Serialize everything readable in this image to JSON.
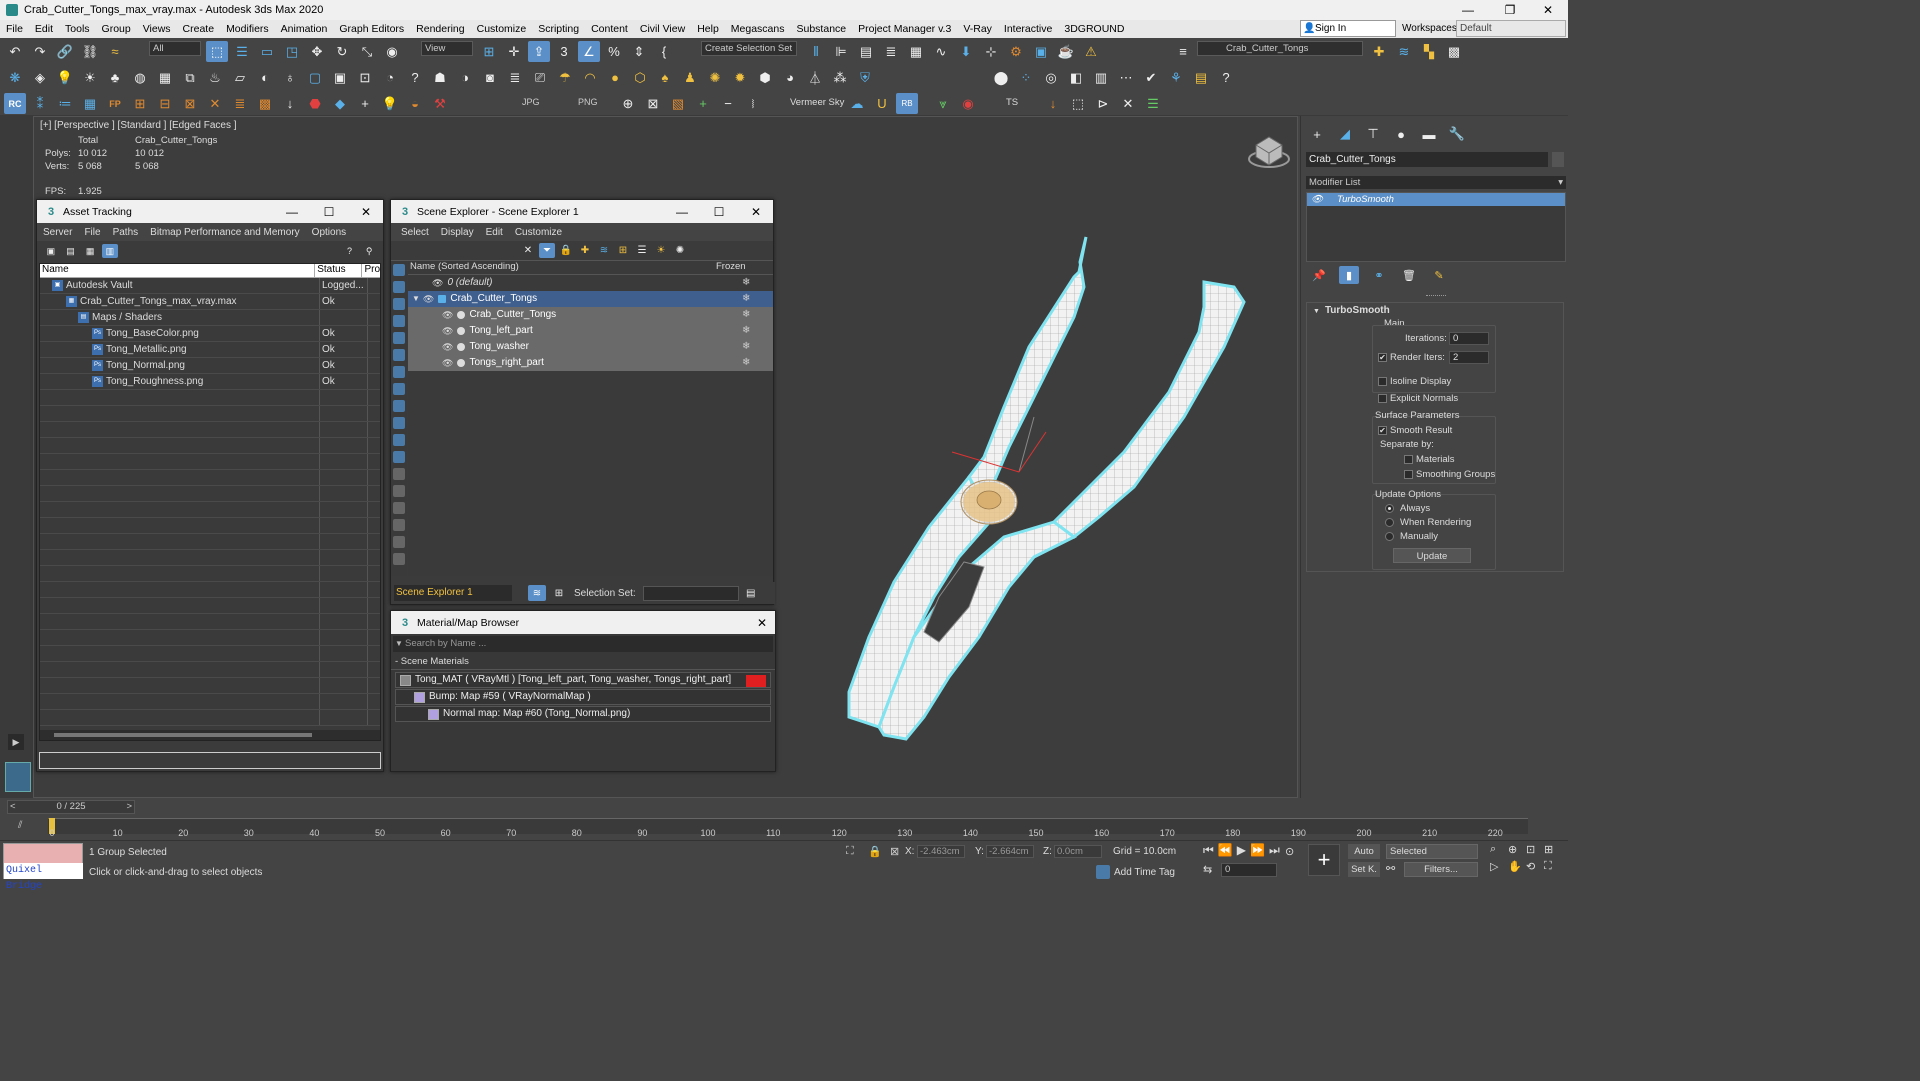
{
  "titlebar": {
    "title": "Crab_Cutter_Tongs_max_vray.max - Autodesk 3ds Max 2020",
    "min": "—",
    "max": "❐",
    "close": "✕"
  },
  "menu": [
    "File",
    "Edit",
    "Tools",
    "Group",
    "Views",
    "Create",
    "Modifiers",
    "Animation",
    "Graph Editors",
    "Rendering",
    "Customize",
    "Scripting",
    "Content",
    "Civil View",
    "Help",
    "Megascans",
    "Substance",
    "Project Manager v.3",
    "V-Ray",
    "Interactive",
    "3DGROUND"
  ],
  "signin": "Sign In",
  "workspaces": {
    "label": "Workspaces:",
    "value": "Default"
  },
  "toolbar1": {
    "filter": "All",
    "view": "View",
    "selection_set": "Create Selection Set",
    "layer": "Crab_Cutter_Tongs"
  },
  "toolbar3": {
    "jpg": "JPG",
    "png": "PNG",
    "vermeer": "Vermeer Sky",
    "ts": "TS",
    "rc": "RC",
    "fp": "FP"
  },
  "viewport": {
    "label": "[+] [Perspective ] [Standard ] [Edged Faces ]",
    "stats": {
      "total_label": "Total",
      "object_label": "Crab_Cutter_Tongs",
      "polys_label": "Polys:",
      "polys_total": "10 012",
      "polys_obj": "10 012",
      "verts_label": "Verts:",
      "verts_total": "5 068",
      "verts_obj": "5 068",
      "fps_label": "FPS:",
      "fps": "1.925"
    }
  },
  "asset_tracking": {
    "title": "Asset Tracking",
    "menu": [
      "Server",
      "File",
      "Paths",
      "Bitmap Performance and Memory",
      "Options"
    ],
    "col_name": "Name",
    "col_status": "Status",
    "col_pro": "Pro",
    "rows": [
      {
        "name": "Autodesk Vault",
        "status": "Logged..."
      },
      {
        "name": "Crab_Cutter_Tongs_max_vray.max",
        "status": "Ok"
      },
      {
        "name": "Maps / Shaders",
        "status": ""
      },
      {
        "name": "Tong_BaseColor.png",
        "status": "Ok"
      },
      {
        "name": "Tong_Metallic.png",
        "status": "Ok"
      },
      {
        "name": "Tong_Normal.png",
        "status": "Ok"
      },
      {
        "name": "Tong_Roughness.png",
        "status": "Ok"
      }
    ]
  },
  "scene_explorer": {
    "title": "Scene Explorer - Scene Explorer 1",
    "menu": [
      "Select",
      "Display",
      "Edit",
      "Customize"
    ],
    "col_name": "Name (Sorted Ascending)",
    "col_frozen": "Frozen",
    "rows": [
      "0 (default)",
      "Crab_Cutter_Tongs",
      "Crab_Cutter_Tongs",
      "Tong_left_part",
      "Tong_washer",
      "Tongs_right_part"
    ],
    "footer_name": "Scene Explorer 1",
    "selection_set_label": "Selection Set:"
  },
  "material_browser": {
    "title": "Material/Map Browser",
    "search_placeholder": "Search by Name ...",
    "section": "- Scene Materials",
    "rows": [
      "Tong_MAT  ( VRayMtl )  [Tong_left_part, Tong_washer, Tongs_right_part]",
      "Bump: Map #59  ( VRayNormalMap )",
      "Normal map: Map #60 (Tong_Normal.png)"
    ]
  },
  "command_panel": {
    "object_name": "Crab_Cutter_Tongs",
    "modifier_list": "Modifier List",
    "modifier": "TurboSmooth",
    "rollout": "TurboSmooth",
    "main": "Main",
    "iterations_label": "Iterations:",
    "iterations": "0",
    "render_iters_label": "Render Iters:",
    "render_iters": "2",
    "isoline": "Isoline Display",
    "explicit": "Explicit Normals",
    "surface": "Surface Parameters",
    "smooth_result": "Smooth Result",
    "separate_by": "Separate by:",
    "materials": "Materials",
    "smoothing_groups": "Smoothing Groups",
    "update_options": "Update Options",
    "always": "Always",
    "when_rendering": "When Rendering",
    "manually": "Manually",
    "update": "Update"
  },
  "timeline": {
    "frame": "0 / 225",
    "ticks": [
      "0",
      "10",
      "20",
      "30",
      "40",
      "50",
      "60",
      "70",
      "80",
      "90",
      "100",
      "110",
      "120",
      "130",
      "140",
      "150",
      "160",
      "170",
      "180",
      "190",
      "200",
      "210",
      "220"
    ]
  },
  "status": {
    "quixel": "Quixel Bridge",
    "selected": "1 Group Selected",
    "prompt": "Click or click-and-drag to select objects",
    "x_label": "X:",
    "x": "-2.463cm",
    "y_label": "Y:",
    "y": "-2.664cm",
    "z_label": "Z:",
    "z": "0.0cm",
    "grid": "Grid = 10.0cm",
    "add_time_tag": "Add Time Tag",
    "auto": "Auto",
    "selected_drop": "Selected",
    "setk": "Set K.",
    "filters": "Filters...",
    "frame": "0"
  },
  "colors": {
    "selection_outline": "#7fe3f0",
    "wire": "#e8e8e8",
    "washer": "#e8c48a",
    "highlight": "#5b8fc7"
  }
}
